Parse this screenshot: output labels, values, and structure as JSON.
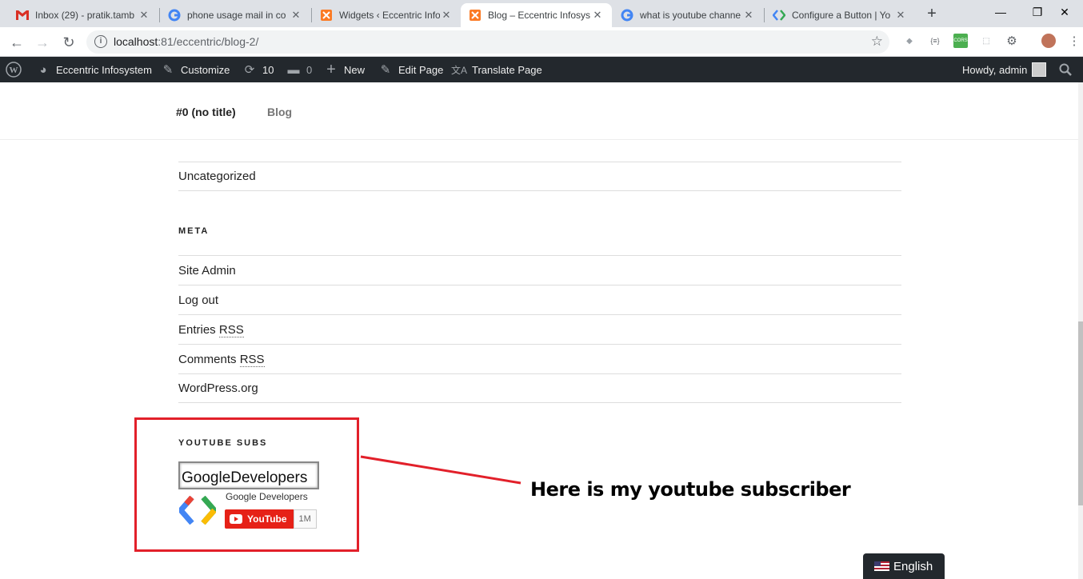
{
  "browser": {
    "tabs": [
      {
        "title": "Inbox (29) - pratik.tamb",
        "icon": "gmail-icon",
        "active": false
      },
      {
        "title": "phone usage mail in co",
        "icon": "google-icon",
        "active": false
      },
      {
        "title": "Widgets ‹ Eccentric Info",
        "icon": "xampp-icon",
        "active": false
      },
      {
        "title": "Blog – Eccentric Infosys",
        "icon": "xampp-icon",
        "active": true
      },
      {
        "title": "what is youtube channe",
        "icon": "google-icon",
        "active": false
      },
      {
        "title": "Configure a Button | Yo",
        "icon": "google-developers-icon",
        "active": false
      }
    ],
    "url_host": "localhost",
    "url_path": ":81/eccentric/blog-2/"
  },
  "adminbar": {
    "site_name": "Eccentric Infosystem",
    "customize": "Customize",
    "updates_count": "10",
    "comments_count": "0",
    "new": "New",
    "edit_page": "Edit Page",
    "translate_page": "Translate Page",
    "howdy": "Howdy, admin"
  },
  "site_nav": {
    "items": [
      "#0 (no title)",
      "Blog"
    ]
  },
  "categories": {
    "items": [
      "Uncategorized"
    ]
  },
  "meta": {
    "title": "META",
    "items": [
      {
        "label": "Site Admin"
      },
      {
        "label": "Log out"
      },
      {
        "prefix": "Entries ",
        "abbr": "RSS"
      },
      {
        "prefix": "Comments ",
        "abbr": "RSS"
      },
      {
        "label": "WordPress.org"
      }
    ]
  },
  "youtube_widget": {
    "title": "YOUTUBE SUBS",
    "input_value": "GoogleDevelopers",
    "channel_name": "Google Developers",
    "button_label": "YouTube",
    "subscriber_count": "1M"
  },
  "annotation": "Here is my youtube subscriber",
  "language_switcher": "English",
  "colors": {
    "admin_bar": "#23282d",
    "highlight_box": "#e2202a",
    "youtube_red": "#e62117"
  }
}
